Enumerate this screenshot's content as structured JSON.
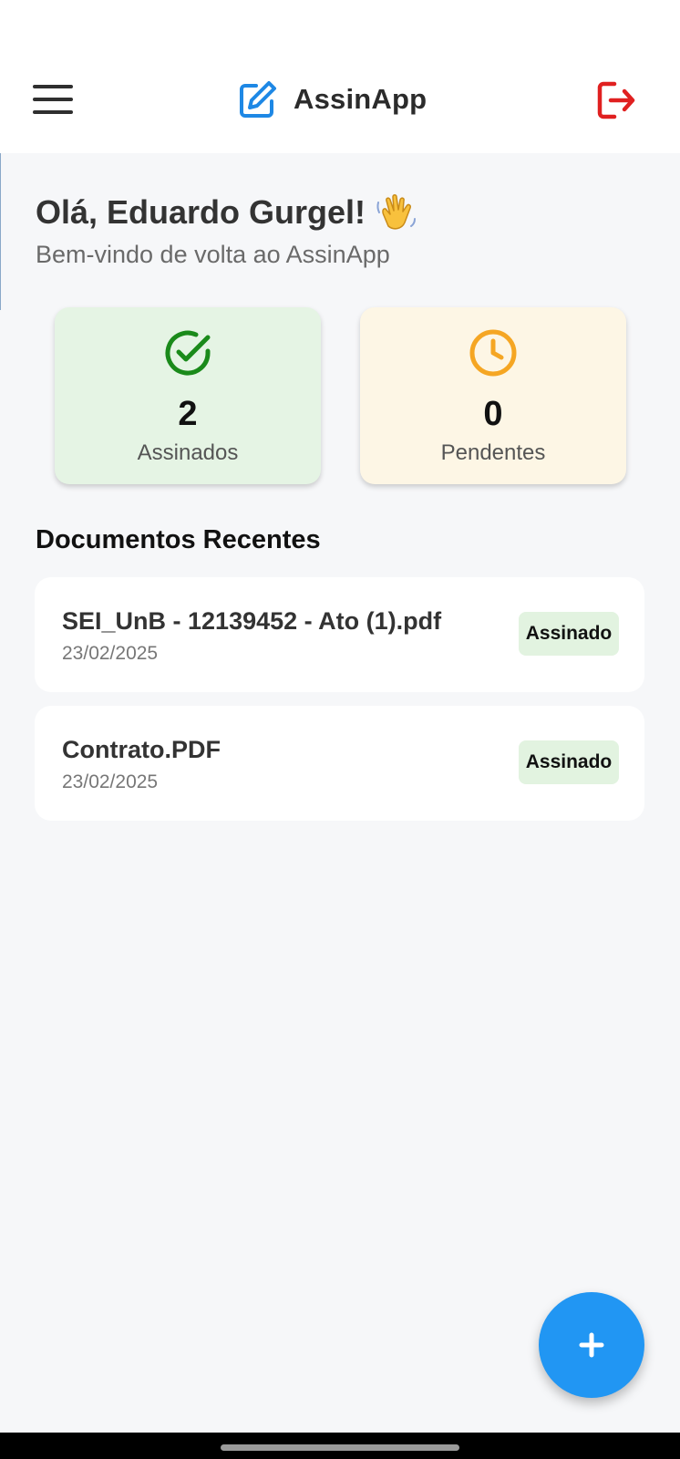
{
  "app": {
    "title": "AssinApp"
  },
  "header": {
    "menu_icon": "hamburger-menu-icon",
    "brand_icon": "edit-square-pen-icon",
    "logout_icon": "logout-icon",
    "brand_color": "#1e88e5",
    "logout_color": "#e02020"
  },
  "greeting": {
    "text": "Olá, Eduardo Gurgel!",
    "icon": "waving-hand-icon",
    "subtitle": "Bem-vindo de volta ao AssinApp"
  },
  "stats": [
    {
      "value": "2",
      "label": "Assinados",
      "icon": "check-circle-icon",
      "color": "#1a8a1a",
      "background": "#e5f4e4"
    },
    {
      "value": "0",
      "label": "Pendentes",
      "icon": "clock-icon",
      "color": "#f5a623",
      "background": "#fdf6e5"
    }
  ],
  "recent": {
    "title": "Documentos Recentes",
    "documents": [
      {
        "name": "SEI_UnB - 12139452 - Ato (1).pdf",
        "date": "23/02/2025",
        "status": "Assinado"
      },
      {
        "name": "Contrato.PDF",
        "date": "23/02/2025",
        "status": "Assinado"
      }
    ]
  },
  "fab": {
    "icon": "plus-icon",
    "color": "#2196f3"
  }
}
